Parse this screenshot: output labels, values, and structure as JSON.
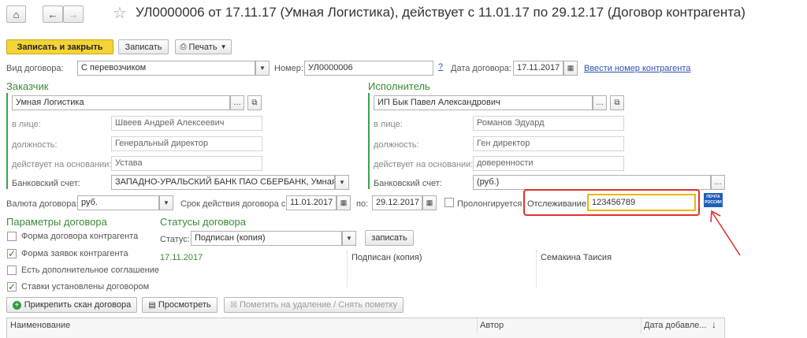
{
  "title": "УЛ0000006 от 17.11.17 (Умная Логистика), действует с 11.01.17 по 29.12.17 (Договор контрагента)",
  "toolbar": {
    "save_close": "Записать и закрыть",
    "save": "Записать",
    "print": "Печать"
  },
  "contract_type": {
    "label": "Вид договора:",
    "value": "С перевозчиком"
  },
  "number": {
    "label": "Номер:",
    "value": "УЛ0000006",
    "help": "?"
  },
  "contract_date": {
    "label": "Дата договора:",
    "value": "17.11.2017",
    "link": "Ввести номер контрагента"
  },
  "customer": {
    "section": "Заказчик",
    "name": "Умная Логистика",
    "person_label": "в лице:",
    "person": "Швеев Андрей Алексеевич",
    "position_label": "должность:",
    "position": "Генеральный директор",
    "basis_label": "действует на основании:",
    "basis": "Устава",
    "bank_label": "Банковский счет:",
    "bank": "ЗАПАДНО-УРАЛЬСКИЙ БАНК ПАО СБЕРБАНК, Умная"
  },
  "executor": {
    "section": "Исполнитель",
    "name": "ИП Бык Павел Александрович",
    "person_label": "в лице:",
    "person": "Романов Эдуард",
    "position_label": "должность:",
    "position": "Ген директор",
    "basis_label": "действует на основании:",
    "basis": "доверенности",
    "bank_label": "Банковский счет:",
    "bank": "(руб.)"
  },
  "currency": {
    "label": "Валюта договора:",
    "value": "руб."
  },
  "period": {
    "label": "Срок действия договора с:",
    "from": "11.01.2017",
    "to_label": "по:",
    "to": "29.12.2017"
  },
  "prolong": {
    "label": "Пролонгируется",
    "checked": false
  },
  "tracking": {
    "label": "Отслеживание:",
    "value": "123456789",
    "logo_line1": "ПОЧТА",
    "logo_line2": "РОССИИ"
  },
  "params": {
    "section": "Параметры договора",
    "items": [
      {
        "label": "Форма договора контрагента",
        "checked": "false"
      },
      {
        "label": "Форма заявок контрагента",
        "checked": "true"
      },
      {
        "label": "Есть дополнительное соглашение",
        "checked": "false"
      },
      {
        "label": "Ставки установлены договором",
        "checked": "true"
      }
    ]
  },
  "statuses": {
    "section": "Статусы договора",
    "status_label": "Статус:",
    "status_value": "Подписан (копия)",
    "save": "записать",
    "date": "17.11.2017",
    "status_text": "Подписан (копия)",
    "author": "Семакина Таисия"
  },
  "attach": {
    "attach": "Прикрепить скан договора",
    "view": "Просмотреть",
    "mark": "Пометить на удаление / Снять пометку"
  },
  "table": {
    "columns": [
      "Наименование",
      "Автор",
      "Дата добавле..."
    ]
  },
  "colors": {
    "accent_yellow": "#f4d337",
    "green": "#3a8b35",
    "highlight_red": "#e0312f",
    "orange": "#f0b400"
  }
}
